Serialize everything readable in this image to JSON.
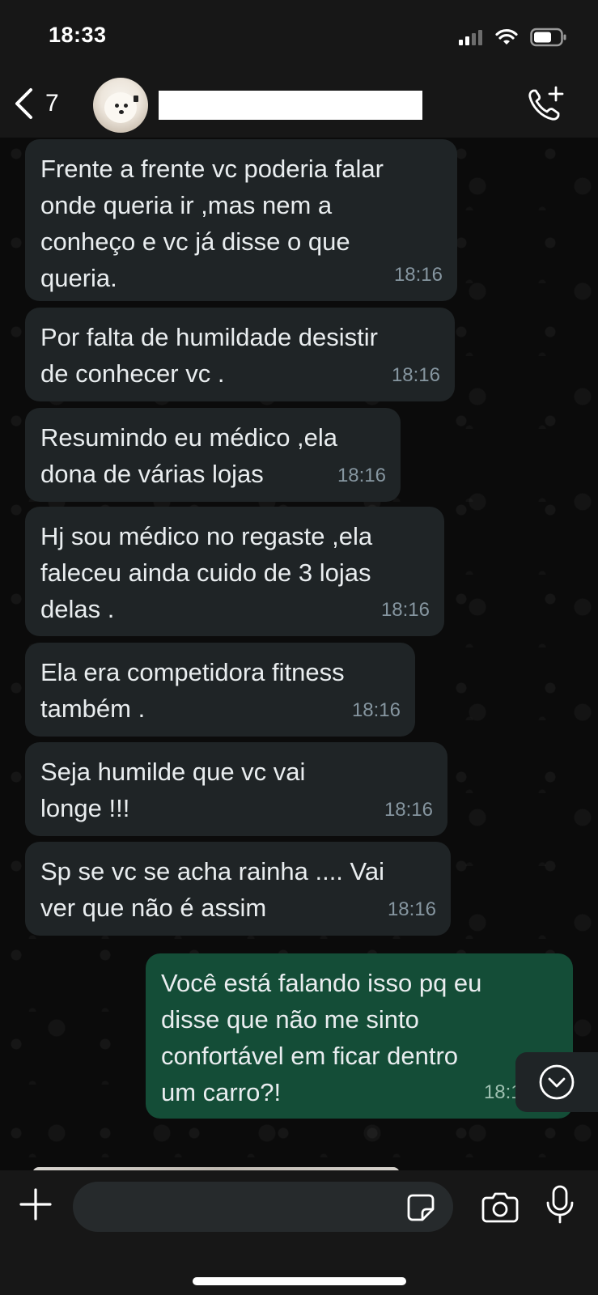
{
  "status_bar": {
    "time": "18:33",
    "icons": [
      "signal-icon",
      "wifi-icon",
      "battery-icon"
    ]
  },
  "header": {
    "back_count": "7",
    "back_icon": "chevron-left-icon",
    "call_icon": "add-call-icon"
  },
  "messages": [
    {
      "direction": "in",
      "text": "Frente a frente vc poderia falar\nonde queria ir ,mas nem a\nconheço e vc já disse o que\nqueria.",
      "time": "18:16"
    },
    {
      "direction": "in",
      "text": "Por falta de humildade desistir\nde conhecer vc .",
      "time": "18:16"
    },
    {
      "direction": "in",
      "text": "Resumindo eu médico ,ela\ndona de várias lojas",
      "time": "18:16"
    },
    {
      "direction": "in",
      "text": "Hj sou médico no regaste ,ela\nfaleceu ainda cuido de 3 lojas\ndelas .",
      "time": "18:16"
    },
    {
      "direction": "in",
      "text": "Ela era competidora fitness\ntambém .",
      "time": "18:16"
    },
    {
      "direction": "in",
      "text": "Seja humilde que vc vai\nlonge !!!",
      "time": "18:16"
    },
    {
      "direction": "in",
      "text": "Sp se vc se acha rainha .... Vai\nver que não é assim",
      "time": "18:16"
    },
    {
      "direction": "out",
      "text": "Você está falando isso pq eu\ndisse que não me sinto\nconfortável em ficar dentro\num carro?!",
      "time": "18:18",
      "status": "read"
    }
  ],
  "composer": {
    "input_value": "",
    "placeholder": ""
  },
  "colors": {
    "incoming_bubble": "#1f2426",
    "outgoing_bubble": "#144d37",
    "read_ticks": "#53bdeb",
    "timestamp": "#8696a0"
  }
}
